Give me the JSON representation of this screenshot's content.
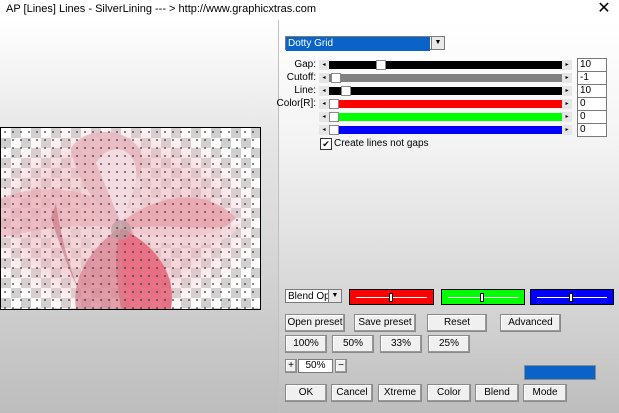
{
  "window": {
    "title": "AP [Lines]  Lines - SilverLining   --- > http://www.graphicxtras.com",
    "close_glyph": "✕"
  },
  "effect_select": {
    "value": "Dotty Grid"
  },
  "params": [
    {
      "label": "Gap:",
      "value": "10",
      "color": "#000000"
    },
    {
      "label": "Cutoff:",
      "value": "-1",
      "color": "#808080"
    },
    {
      "label": "Line:",
      "value": "10",
      "color": "#000000"
    },
    {
      "label": "Color[R]:",
      "value": "0",
      "color": "#ff0000"
    },
    {
      "label": "",
      "value": "0",
      "color": "#00ff00"
    },
    {
      "label": "",
      "value": "0",
      "color": "#0000ff"
    }
  ],
  "checkbox": {
    "label": "Create lines not gaps",
    "checked": true,
    "mark": "✔"
  },
  "blend_select": {
    "value": "Blend Opti"
  },
  "color_swatches": [
    {
      "name": "red",
      "color": "#ff0000",
      "level": 0.5
    },
    {
      "name": "green",
      "color": "#00ff00",
      "level": 0.5
    },
    {
      "name": "blue",
      "color": "#0000ff",
      "level": 0.5
    }
  ],
  "buttons": {
    "open_preset": "Open preset",
    "save_preset": "Save preset",
    "reset": "Reset",
    "advanced": "Advanced",
    "zoom_100": "100%",
    "zoom_50": "50%",
    "zoom_33": "33%",
    "zoom_25": "25%",
    "zoom_plus": "+",
    "zoom_minus": "−",
    "ok": "OK",
    "cancel": "Cancel",
    "xtreme": "Xtreme",
    "color": "Color",
    "blend": "Blend",
    "mode": "Mode"
  },
  "zoom_value": "50%",
  "accent_color": "#0a64c8"
}
